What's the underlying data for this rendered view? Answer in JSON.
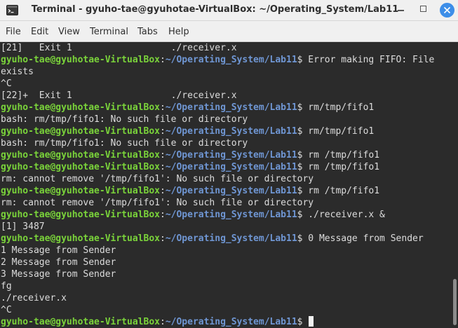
{
  "window": {
    "title": "Terminal - gyuho-tae@gyuhotae-VirtualBox: ~/Operating_System/Lab11"
  },
  "menu": [
    "File",
    "Edit",
    "View",
    "Terminal",
    "Tabs",
    "Help"
  ],
  "prompt": {
    "user_host": "gyuho-tae@gyuhotae-VirtualBox",
    "colon": ":",
    "path": "~/Operating_System/Lab11",
    "dollar": "$"
  },
  "lines": [
    {
      "type": "out",
      "text": "[21]   Exit 1                  ./receiver.x"
    },
    {
      "type": "prompt",
      "text": " Error making FIFO: File"
    },
    {
      "type": "out",
      "text": "exists"
    },
    {
      "type": "out",
      "text": "^C"
    },
    {
      "type": "out",
      "text": "[22]+  Exit 1                  ./receiver.x"
    },
    {
      "type": "prompt",
      "text": " rm/tmp/fifo1"
    },
    {
      "type": "out",
      "text": "bash: rm/tmp/fifo1: No such file or directory"
    },
    {
      "type": "prompt",
      "text": " rm/tmp/fifo1"
    },
    {
      "type": "out",
      "text": "bash: rm/tmp/fifo1: No such file or directory"
    },
    {
      "type": "prompt",
      "text": " rm /tmp/fifo1"
    },
    {
      "type": "prompt",
      "text": " rm /tmp/fifo1"
    },
    {
      "type": "out",
      "text": "rm: cannot remove '/tmp/fifo1': No such file or directory"
    },
    {
      "type": "prompt",
      "text": " rm /tmp/fifo1"
    },
    {
      "type": "out",
      "text": "rm: cannot remove '/tmp/fifo1': No such file or directory"
    },
    {
      "type": "prompt",
      "text": " ./receiver.x &"
    },
    {
      "type": "out",
      "text": "[1] 3487"
    },
    {
      "type": "prompt",
      "text": " 0 Message from Sender"
    },
    {
      "type": "out",
      "text": "1 Message from Sender"
    },
    {
      "type": "out",
      "text": "2 Message from Sender"
    },
    {
      "type": "out",
      "text": "3 Message from Sender"
    },
    {
      "type": "out",
      "text": "fg"
    },
    {
      "type": "out",
      "text": "./receiver.x"
    },
    {
      "type": "out",
      "text": "^C"
    },
    {
      "type": "prompt",
      "text": " ",
      "cursor": true
    }
  ],
  "colors": {
    "background": "#2b2b2b",
    "user_host": "#7ad33a",
    "path": "#6f96d3",
    "text": "#dcdcdc",
    "close_button": "#3d8ee8"
  },
  "icons": [
    "terminal-app-icon",
    "minimize-icon",
    "maximize-icon",
    "close-icon"
  ]
}
